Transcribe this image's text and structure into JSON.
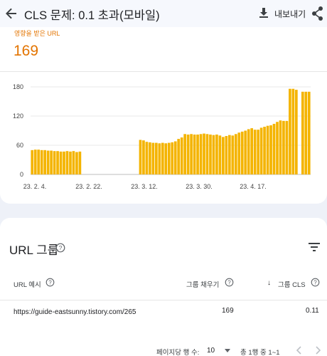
{
  "appbar": {
    "title": "CLS 문제: 0.1 초과(모바일)",
    "export_label": "내보내기",
    "icons": {
      "back": "arrow-back-icon",
      "export": "download-icon",
      "share": "share-icon"
    }
  },
  "summary": {
    "affected_label": "영향을 받은 URL",
    "affected_value": "169",
    "accent_color": "#e37400"
  },
  "chart_data": {
    "type": "bar",
    "color": "#f4b400",
    "ylim": [
      0,
      180
    ],
    "y_ticks": [
      "0",
      "60",
      "120",
      "180"
    ],
    "x_ticks": [
      "23. 2. 4.",
      "23. 2. 22.",
      "23. 3. 12.",
      "23. 3. 30.",
      "23. 4. 17."
    ],
    "grid": true,
    "series": [
      {
        "values": [
          50,
          51,
          51,
          50,
          50,
          49,
          49,
          48,
          48,
          47,
          47,
          48,
          47,
          48,
          46,
          47,
          null,
          null,
          null,
          null,
          null,
          null,
          null,
          null,
          null,
          null,
          null,
          null,
          null,
          null,
          null,
          null,
          null,
          null,
          71,
          70,
          67,
          66,
          65,
          65,
          64,
          65,
          64,
          65,
          66,
          68,
          73,
          76,
          83,
          82,
          83,
          82,
          82,
          83,
          84,
          83,
          82,
          81,
          82,
          80,
          77,
          79,
          81,
          80,
          83,
          86,
          88,
          90,
          93,
          95,
          92,
          92,
          96,
          98,
          100,
          101,
          104,
          108,
          111,
          110,
          110,
          176,
          176,
          174,
          null,
          170,
          170,
          170
        ]
      }
    ]
  },
  "url_groups": {
    "title": "URL 그룹",
    "columns": {
      "url": "URL 예시",
      "fill": "그룹 채우기",
      "cls": "그룹 CLS"
    },
    "rows": [
      {
        "url": "https://guide-eastsunny.tistory.com/265",
        "fill": "169",
        "cls": "0.11"
      }
    ],
    "pagination": {
      "rows_per_page_label": "페이지당 행 수:",
      "rows_per_page_value": "10",
      "range_text": "총 1행 중 1~1"
    }
  }
}
